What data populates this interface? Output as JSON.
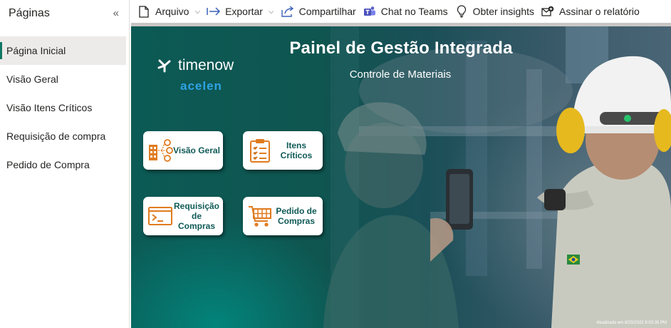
{
  "sidebar": {
    "title": "Páginas",
    "pages": [
      {
        "label": "Página Inicial",
        "active": true
      },
      {
        "label": "Visão Geral",
        "active": false
      },
      {
        "label": "Visão Itens Críticos",
        "active": false
      },
      {
        "label": "Requisição de compra",
        "active": false
      },
      {
        "label": "Pedido de Compra",
        "active": false
      }
    ]
  },
  "toolbar": {
    "arquivo": "Arquivo",
    "exportar": "Exportar",
    "compartilhar": "Compartilhar",
    "chat_teams": "Chat no Teams",
    "insights": "Obter insights",
    "assinar": "Assinar o relatório"
  },
  "report": {
    "title": "Painel de Gestão Integrada",
    "subtitle": "Controle de Materiais",
    "logo_timenow": "timenow",
    "logo_acelen": "acelen",
    "cards": {
      "visao_geral": "Visão Geral",
      "itens_criticos": "Itens Críticos",
      "requisicao": "Requisição de Compras",
      "pedido": "Pedido de Compras"
    },
    "status": "Atualizado em 8/23/2022 8:03:35 PM"
  },
  "colors": {
    "accent_teal": "#117865",
    "card_text": "#0f5a57",
    "card_icon": "#e07b20",
    "acelen_blue": "#2fa3e6"
  },
  "icons": {
    "collapse": "double-chevron-left-icon",
    "arquivo": "document-icon",
    "exportar": "export-arrow-icon",
    "compartilhar": "share-icon",
    "chat_teams": "teams-icon",
    "insights": "lightbulb-icon",
    "assinar": "subscribe-icon"
  }
}
